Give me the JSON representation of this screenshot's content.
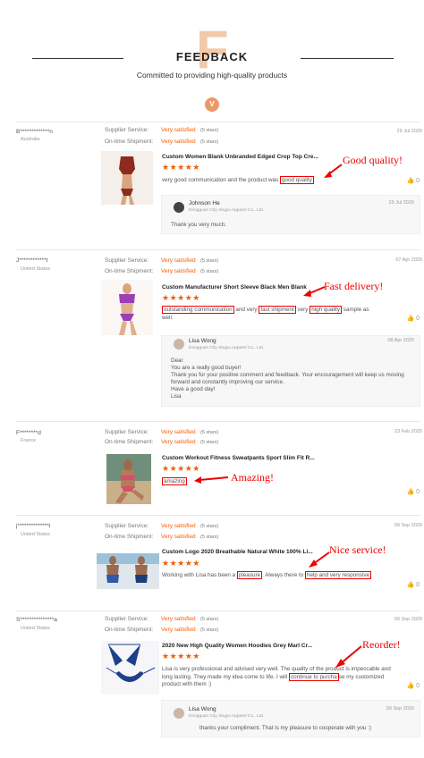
{
  "header": {
    "big_letter": "F",
    "title": "FEEDBACK",
    "subtitle": "Committed to providing high-quality products",
    "badge": "V"
  },
  "labels": {
    "supplier_service": "Supplier Service:",
    "ontime_shipment": "On-time Shipment:",
    "very_satisfied": "Very satisfied",
    "five_stars": "(5 stars)",
    "stars": "★★★★★"
  },
  "reviews": [
    {
      "user": "B*************n",
      "country": "Australia",
      "date": "29 Jul 2020",
      "product": "Custom Women Blank Unbranded Edged Crop Top Cre...",
      "text_a": "very good communication and the product was ",
      "hl1": "good quality",
      "annotation": "Good quality!",
      "reply": {
        "name": "Johnson He",
        "company": "Dongguan City Jingyu Apparel Co., Ltd.",
        "date": "29 Jul 2020",
        "text": "Thank you very much."
      }
    },
    {
      "user": "J************t",
      "country": "United States",
      "date": "07 Apr 2020",
      "product": "Custom Manufacturer Short Sleeve Black Men Blank",
      "hl1": "outstanding communication",
      "text_a": " and very ",
      "hl2": "fast shipment",
      "text_b": " very ",
      "hl3": "high quality",
      "text_c": " sample as well.",
      "annotation": "Fast delivery!",
      "reply": {
        "name": "Lisa Wong",
        "company": "Dongguan City Jingyu Apparel Co., Ltd.",
        "date": "08 Apr 2020",
        "lines": [
          "Dear",
          "You are a really good buyer!",
          "Thank you for your positive comment and feedback. Your encouragement will keep us moving forward and constantly improving our service.",
          "Have a good day!",
          "Lisa"
        ]
      }
    },
    {
      "user": "F********d",
      "country": "France",
      "date": "23 Feb 2020",
      "product": "Custom Workout Fitness Sweatpants Sport Slim Fit R...",
      "hl1": "amazing",
      "annotation": "Amazing!"
    },
    {
      "user": "j**************i",
      "country": "United States",
      "date": "09 Sep 2020",
      "product": "Custom Logo 2020 Breathable Natural White 100% Li...",
      "text_a": "Working with Lisa has been a ",
      "hl1": "pleasure",
      "text_b": ". Always there to ",
      "hl2": "help and very responsive",
      "annotation": "Nice service!"
    },
    {
      "user": "S***************a",
      "country": "United States",
      "date": "09 Sep 2020",
      "product": "2020 New High Quality Women Hoodies Grey Marl Cr...",
      "text_a": "Lisa is very professional and advised very well. The quality of the product is impeccable and long lasting. They made my idea come to life. I will ",
      "hl1": "continue to purcha",
      "text_b": "se my customized product with them :)",
      "annotation": "Reorder!",
      "reply": {
        "name": "Lisa Wong",
        "company": "Dongguan City Jingyu Apparel Co., Ltd.",
        "date": "09 Sep 2020",
        "text": "thanks your compliment. That is my pleasure to cooperate with you :)"
      }
    }
  ],
  "colors": {
    "accent": "#f25c05",
    "annotation": "#e00000",
    "badge": "#e89a6a"
  }
}
